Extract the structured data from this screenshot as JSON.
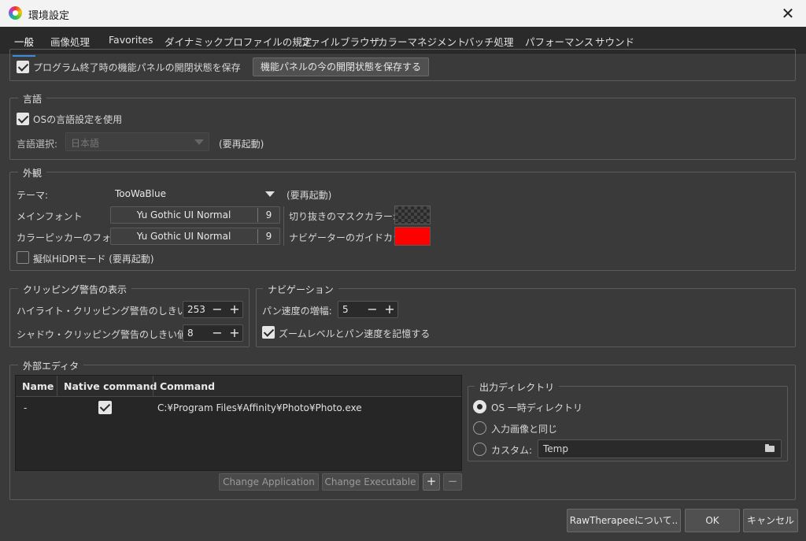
{
  "window": {
    "title": "環境設定",
    "close_symbol": "✕"
  },
  "tabs": [
    "一般",
    "画像処理",
    "Favorites",
    "ダイナミックプロファイルの規定",
    "ファイルブラウザ",
    "カラーマネジメント",
    "バッチ処理",
    "パフォーマンス",
    "サウンド"
  ],
  "panel_state": {
    "checkbox_label": "プログラム終了時の機能パネルの開閉状態を保存",
    "checked": true,
    "save_button": "機能パネルの今の開閉状態を保存する"
  },
  "language": {
    "section_title": "言語",
    "use_os_label": "OSの言語設定を使用",
    "use_os_checked": true,
    "select_label": "言語選択:",
    "select_value": "日本語",
    "restart_note": "(要再起動)"
  },
  "appearance": {
    "section_title": "外観",
    "theme_label": "テーマ:",
    "theme_value": "TooWaBlue",
    "theme_note": "(要再起動)",
    "main_font_label": "メインフォント",
    "main_font_name": "Yu Gothic UI Normal",
    "main_font_size": "9",
    "picker_font_label": "カラーピッカーのフォント:",
    "picker_font_name": "Yu Gothic UI Normal",
    "picker_font_size": "9",
    "crop_mask_label": "切り抜きのマスクカラー:",
    "navigator_guide_label": "ナビゲーターのガイドカラー:",
    "navigator_guide_color": "#ff0000",
    "hidpi_label": "擬似HiDPIモード (要再起動)",
    "hidpi_checked": false
  },
  "clipping": {
    "section_title": "クリッピング警告の表示",
    "highlight_label": "ハイライト・クリッピング警告のしきい値:",
    "highlight_value": "253",
    "shadow_label": "シャドウ・クリッピング警告のしきい値:",
    "shadow_value": "8",
    "minus": "−",
    "plus": "+"
  },
  "navigation": {
    "section_title": "ナビゲーション",
    "pan_label": "パン速度の増幅:",
    "pan_value": "5",
    "remember_label": "ズームレベルとパン速度を記憶する",
    "remember_checked": true
  },
  "external_editor": {
    "section_title": "外部エディタ",
    "columns": [
      "Name",
      "Native command",
      "Command"
    ],
    "rows": [
      {
        "name": "-",
        "native": true,
        "command": "C:¥Program Files¥Affinity¥Photo¥Photo.exe"
      }
    ],
    "change_application": "Change Application",
    "change_executable": "Change Executable",
    "add": "+",
    "remove": "−"
  },
  "output_dir": {
    "section_title": "出力ディレクトリ",
    "options": [
      "OS 一時ディレクトリ",
      "入力画像と同じ",
      "カスタム:"
    ],
    "selected": 0,
    "custom_path": "Temp"
  },
  "footer": {
    "about": "RawTherapeeについて..",
    "ok": "OK",
    "cancel": "キャンセル"
  }
}
